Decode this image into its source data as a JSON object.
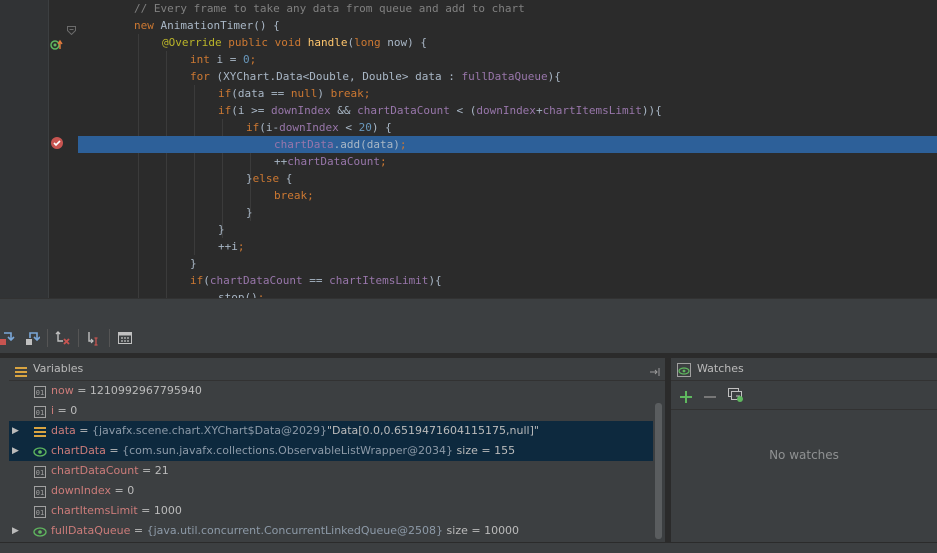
{
  "editor": {
    "lines": [
      [
        [
          "c-comment",
          "// Every frame to take any data from queue and add to chart"
        ]
      ],
      [
        [
          "c-kw",
          "new "
        ],
        [
          "c-txt",
          "AnimationTimer() {"
        ]
      ],
      [
        [
          "c-ann",
          "@Override "
        ],
        [
          "c-kw",
          "public void "
        ],
        [
          "c-fn",
          "handle"
        ],
        [
          "c-txt",
          "("
        ],
        [
          "c-kw",
          "long "
        ],
        [
          "c-txt",
          "now) {"
        ]
      ],
      [
        [
          "c-kw",
          "int "
        ],
        [
          "c-txt",
          "i = "
        ],
        [
          "c-num",
          "0"
        ],
        [
          "c-kw",
          ";"
        ]
      ],
      [
        [
          "c-kw",
          "for "
        ],
        [
          "c-txt",
          "(XYChart.Data<Double, Double> data : "
        ],
        [
          "c-field",
          "fullDataQueue"
        ],
        [
          "c-txt",
          ")"
        ],
        [
          "c-txt",
          "{"
        ]
      ],
      [
        [
          "c-kw",
          "if"
        ],
        [
          "c-txt",
          "(data == "
        ],
        [
          "c-kw",
          "null"
        ],
        [
          "c-txt",
          ") "
        ],
        [
          "c-kw",
          "break;"
        ]
      ],
      [
        [
          "c-kw",
          "if"
        ],
        [
          "c-txt",
          "(i >= "
        ],
        [
          "c-field",
          "downIndex"
        ],
        [
          "c-txt",
          " && "
        ],
        [
          "c-field",
          "chartDataCount"
        ],
        [
          "c-txt",
          " < ("
        ],
        [
          "c-field",
          "downIndex"
        ],
        [
          "c-txt",
          "+"
        ],
        [
          "c-field",
          "chartItemsLimit"
        ],
        [
          "c-txt",
          "))"
        ],
        [
          "c-txt",
          "{"
        ]
      ],
      [
        [
          "c-kw",
          "if"
        ],
        [
          "c-txt",
          "(i-"
        ],
        [
          "c-field",
          "downIndex"
        ],
        [
          "c-txt",
          " < "
        ],
        [
          "c-num",
          "20"
        ],
        [
          "c-txt",
          ") {"
        ]
      ],
      [
        [
          "c-field",
          "chartData"
        ],
        [
          "c-txt",
          ".add(data)"
        ],
        [
          "c-kw",
          ";"
        ]
      ],
      [
        [
          "c-txt",
          "++"
        ],
        [
          "c-field",
          "chartDataCount"
        ],
        [
          "c-kw",
          ";"
        ]
      ],
      [
        [
          "c-txt",
          "}"
        ],
        [
          "c-kw",
          "else "
        ],
        [
          "c-txt",
          "{"
        ]
      ],
      [
        [
          "c-kw",
          "break;"
        ]
      ],
      [
        [
          "c-txt",
          "}"
        ]
      ],
      [
        [
          "c-txt",
          "}"
        ]
      ],
      [
        [
          "c-txt",
          "++i"
        ],
        [
          "c-kw",
          ";"
        ]
      ],
      [
        [
          "c-txt",
          "}"
        ]
      ],
      [
        [
          "c-kw",
          "if"
        ],
        [
          "c-txt",
          "("
        ],
        [
          "c-field",
          "chartDataCount"
        ],
        [
          "c-txt",
          " == "
        ],
        [
          "c-field",
          "chartItemsLimit"
        ],
        [
          "c-txt",
          "){"
        ]
      ],
      [
        [
          "c-txt",
          "stop()"
        ],
        [
          "c-kw",
          ";"
        ]
      ]
    ]
  },
  "variables_panel": {
    "title": "Variables",
    "rows": [
      {
        "name": "now",
        "eq": " = ",
        "value": "1210992967795940",
        "type": "",
        "extra": ""
      },
      {
        "name": "i",
        "eq": " = ",
        "value": "0",
        "type": "",
        "extra": ""
      },
      {
        "name": "data",
        "eq": " = ",
        "value": "",
        "type": "{javafx.scene.chart.XYChart$Data@2029}",
        "extra": "\"Data[0.0,0.6519471604115175,null]\""
      },
      {
        "name": "chartData",
        "eq": " = ",
        "value": "",
        "type": "{com.sun.javafx.collections.ObservableListWrapper@2034}",
        "extra": " size = 155"
      },
      {
        "name": "chartDataCount",
        "eq": " = ",
        "value": "21",
        "type": "",
        "extra": ""
      },
      {
        "name": "downIndex",
        "eq": " = ",
        "value": "0",
        "type": "",
        "extra": ""
      },
      {
        "name": "chartItemsLimit",
        "eq": " = ",
        "value": "1000",
        "type": "",
        "extra": ""
      },
      {
        "name": "fullDataQueue",
        "eq": " = ",
        "value": "",
        "type": "{java.util.concurrent.ConcurrentLinkedQueue@2508}",
        "extra": " size = 10000"
      }
    ]
  },
  "watches_panel": {
    "title": "Watches",
    "empty_text": "No watches"
  }
}
